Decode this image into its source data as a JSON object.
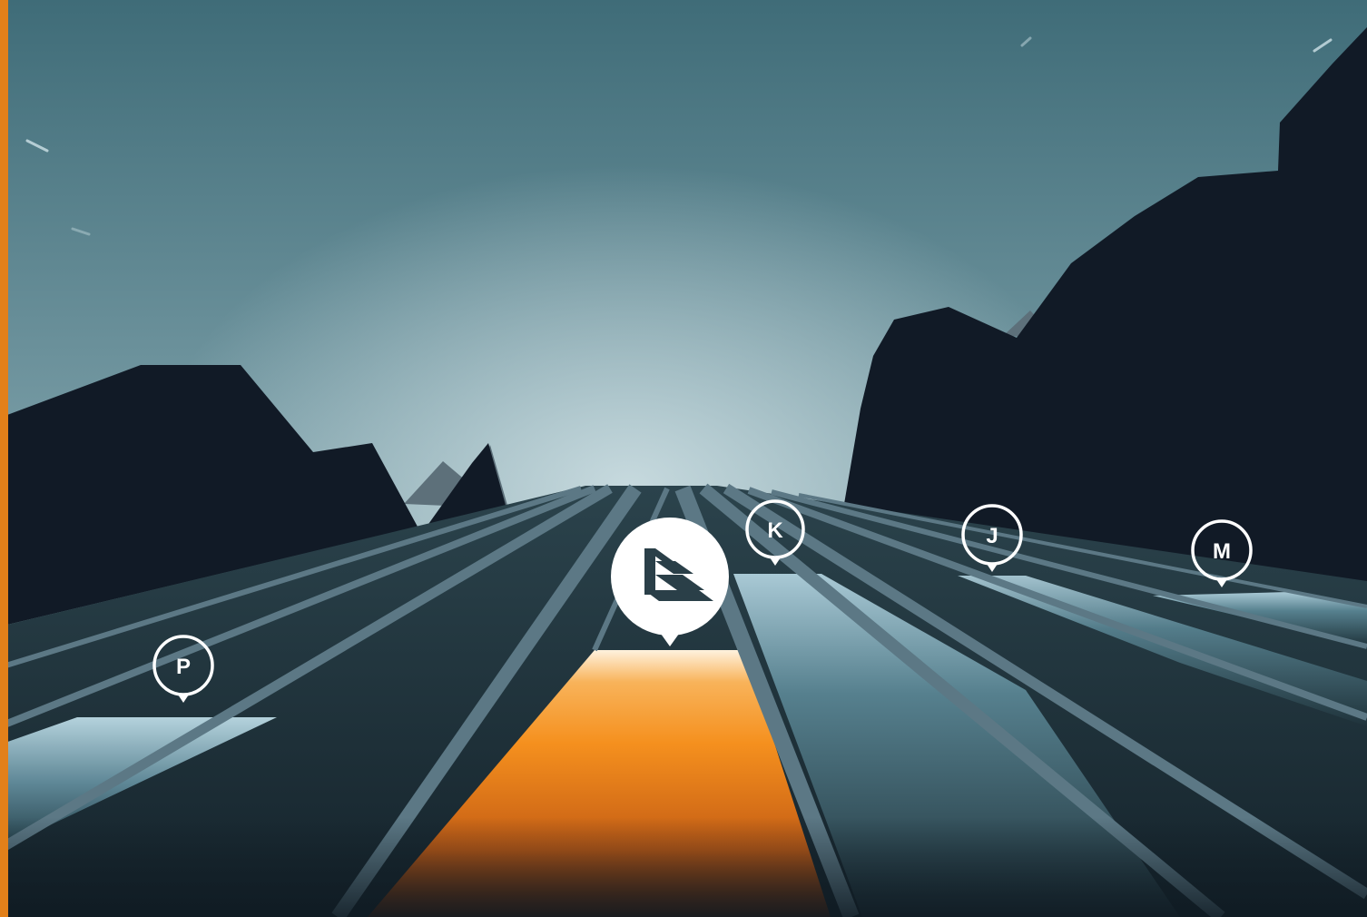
{
  "markers": [
    {
      "id": "brand",
      "label": "",
      "icon": "brand-logo-icon"
    },
    {
      "id": "k",
      "label": "K",
      "icon": "map-pin-icon"
    },
    {
      "id": "j",
      "label": "J",
      "icon": "map-pin-icon"
    },
    {
      "id": "m",
      "label": "M",
      "icon": "map-pin-icon"
    },
    {
      "id": "p",
      "label": "P",
      "icon": "map-pin-icon"
    }
  ],
  "colors": {
    "accent_orange": "#f5901e",
    "left_edge_bar": "#e2801a",
    "sky_top": "#3f6c78",
    "sky_horizon": "#b6ced4",
    "mountain_dark": "#111a26",
    "track_surface": "#1f333b",
    "track_divider": "#5c7885",
    "lane_highlight_blue": "#9ec4d2"
  }
}
